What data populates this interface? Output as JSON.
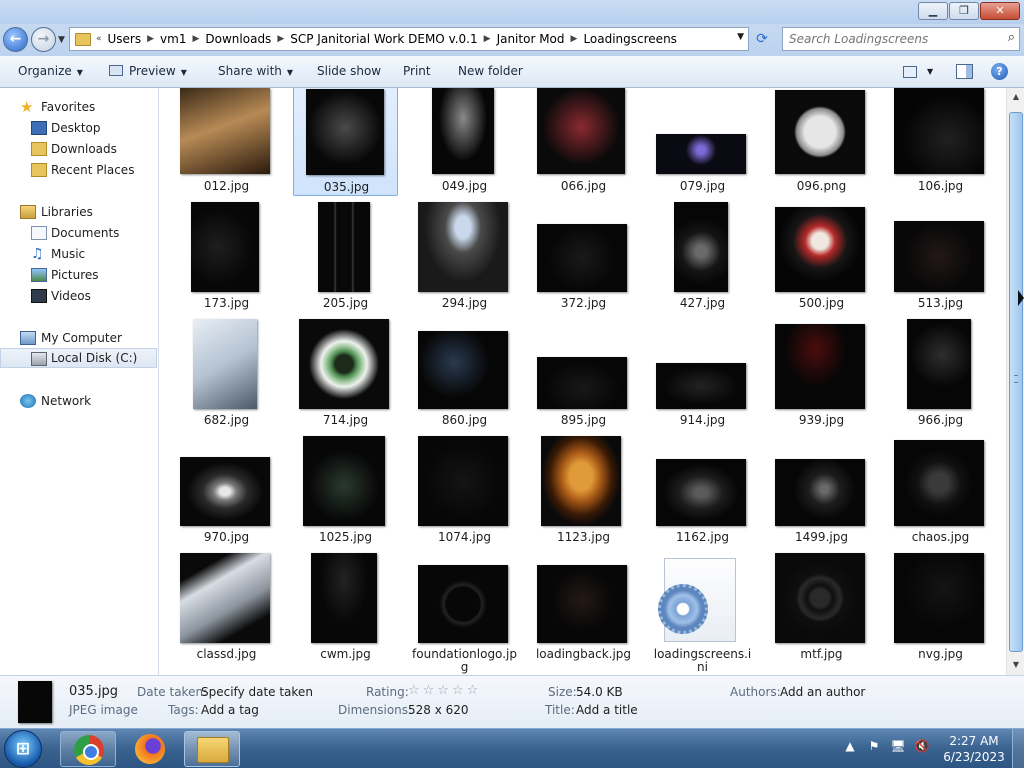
{
  "window": {
    "controls": {
      "minimize": "▁",
      "maximize": "❐",
      "close": "✕"
    }
  },
  "address": {
    "breadcrumbs": [
      "Users",
      "vm1",
      "Downloads",
      "SCP Janitorial Work DEMO v.0.1",
      "Janitor Mod",
      "Loadingscreens"
    ],
    "overflow": "«",
    "search_placeholder": "Search Loadingscreens"
  },
  "toolbar": {
    "organize": "Organize",
    "preview": "Preview",
    "share_with": "Share with",
    "slide_show": "Slide show",
    "print": "Print",
    "new_folder": "New folder"
  },
  "sidebar": {
    "favorites": "Favorites",
    "desktop": "Desktop",
    "downloads": "Downloads",
    "recent_places": "Recent Places",
    "libraries": "Libraries",
    "documents": "Documents",
    "music": "Music",
    "pictures": "Pictures",
    "videos": "Videos",
    "my_computer": "My Computer",
    "local_disk": "Local Disk (C:)",
    "network": "Network"
  },
  "files": [
    "012.jpg",
    "035.jpg",
    "049.jpg",
    "066.jpg",
    "079.jpg",
    "096.png",
    "106.jpg",
    "173.jpg",
    "205.jpg",
    "294.jpg",
    "372.jpg",
    "427.jpg",
    "500.jpg",
    "513.jpg",
    "682.jpg",
    "714.jpg",
    "860.jpg",
    "895.jpg",
    "914.jpg",
    "939.jpg",
    "966.jpg",
    "970.jpg",
    "1025.jpg",
    "1074.jpg",
    "1123.jpg",
    "1162.jpg",
    "1499.jpg",
    "chaos.jpg",
    "classd.jpg",
    "cwm.jpg",
    "foundationlogo.jpg",
    "loadingback.jpg",
    "loadingscreens.ini",
    "mtf.jpg",
    "nvg.jpg"
  ],
  "selected_file": "035.jpg",
  "details": {
    "name": "035.jpg",
    "type": "JPEG image",
    "date_taken_label": "Date taken:",
    "date_taken_value": "Specify date taken",
    "tags_label": "Tags:",
    "tags_value": "Add a tag",
    "rating_label": "Rating:",
    "rating_stars": "☆☆☆☆☆",
    "dimensions_label": "Dimensions:",
    "dimensions_value": "528 x 620",
    "size_label": "Size:",
    "size_value": "54.0 KB",
    "title_label": "Title:",
    "title_value": "Add a title",
    "authors_label": "Authors:",
    "authors_value": "Add an author"
  },
  "taskbar": {
    "start": "⊞",
    "time": "2:27 AM",
    "date": "6/23/2023",
    "tray_icons": [
      "▲",
      "⚑",
      "🖥",
      "🔇"
    ]
  },
  "colors": {
    "accent": "#2a67c9",
    "selection": "#cfe3fc"
  }
}
